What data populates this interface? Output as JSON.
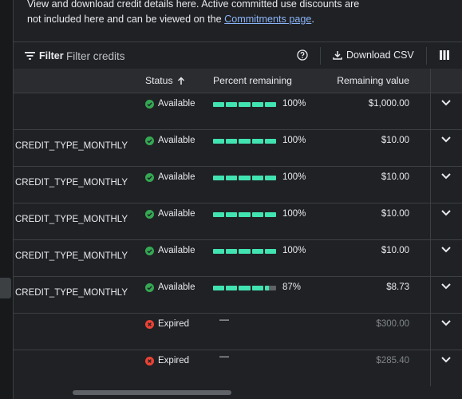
{
  "intro": {
    "text": "View and download credit details here. Active committed use discounts are not included here and can be viewed on the ",
    "link": "Commitments page",
    "suffix": "."
  },
  "toolbar": {
    "filter_label": "Filter",
    "filter_placeholder": "Filter credits",
    "help_icon": "help-circle-icon",
    "download_label": "Download CSV",
    "columns_icon": "column-display-icon"
  },
  "table": {
    "headers": {
      "status": "Status",
      "percent": "Percent remaining",
      "value": "Remaining value"
    },
    "sort": "ascending",
    "rows": [
      {
        "name": "",
        "status": "Available",
        "status_type": "available",
        "percent": 100,
        "percent_label": "100%",
        "value": "$1,000.00",
        "muted": false
      },
      {
        "name": "fit - CREDIT_TYPE_MONTHLY",
        "status": "Available",
        "status_type": "available",
        "percent": 100,
        "percent_label": "100%",
        "value": "$10.00",
        "muted": false
      },
      {
        "name": "fit - CREDIT_TYPE_MONTHLY",
        "status": "Available",
        "status_type": "available",
        "percent": 100,
        "percent_label": "100%",
        "value": "$10.00",
        "muted": false
      },
      {
        "name": "fit - CREDIT_TYPE_MONTHLY",
        "status": "Available",
        "status_type": "available",
        "percent": 100,
        "percent_label": "100%",
        "value": "$10.00",
        "muted": false
      },
      {
        "name": "fit - CREDIT_TYPE_MONTHLY",
        "status": "Available",
        "status_type": "available",
        "percent": 100,
        "percent_label": "100%",
        "value": "$10.00",
        "muted": false
      },
      {
        "name": "fit - CREDIT_TYPE_MONTHLY",
        "status": "Available",
        "status_type": "available",
        "percent": 87,
        "percent_label": "87%",
        "value": "$8.73",
        "muted": false
      },
      {
        "name": "",
        "status": "Expired",
        "status_type": "expired",
        "percent": null,
        "percent_label": "—",
        "value": "$300.00",
        "muted": true
      },
      {
        "name": "",
        "status": "Expired",
        "status_type": "expired",
        "percent": null,
        "percent_label": "—",
        "value": "$285.40",
        "muted": true
      }
    ]
  },
  "colors": {
    "background": "#202124",
    "accent_bar": "#41e3b1",
    "available": "#34a853",
    "expired": "#ea4335",
    "link": "#8ab4f8"
  }
}
